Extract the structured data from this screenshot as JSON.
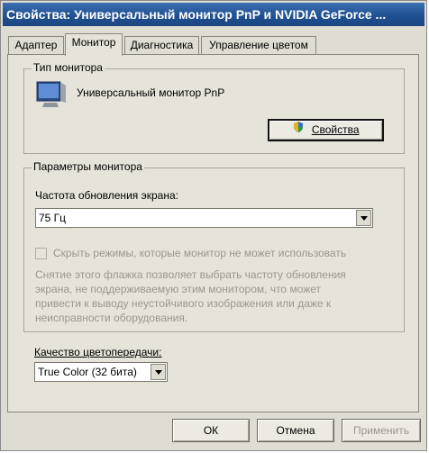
{
  "window": {
    "title": "Свойства: Универсальный монитор PnP и NVIDIA GeForce ..."
  },
  "tabs": [
    {
      "label": "Адаптер",
      "active": false
    },
    {
      "label": "Монитор",
      "active": true
    },
    {
      "label": "Диагностика",
      "active": false
    },
    {
      "label": "Управление цветом",
      "active": false
    }
  ],
  "monitor_type": {
    "group_label": "Тип монитора",
    "monitor_name": "Универсальный монитор PnP",
    "properties_button_label": "Свойства",
    "monitor_icon": "monitor-icon",
    "shield_icon": "shield-icon"
  },
  "monitor_params": {
    "group_label": "Параметры монитора",
    "refresh_rate_label": "Частота обновления экрана:",
    "refresh_rate_value": "75 Гц",
    "hide_modes_label": "Скрыть режимы, которые монитор не может использовать",
    "hide_modes_checked": false,
    "hide_modes_enabled": false,
    "warning_text_line1": "Снятие этого флажка позволяет выбрать частоту обновления",
    "warning_text_line2": "экрана, не поддерживаемую этим монитором, что может",
    "warning_text_line3": "привести к выводу неустойчивого изображения или даже к",
    "warning_text_line4": "неисправности оборудования."
  },
  "color_quality": {
    "label": "Качество цветопередачи:",
    "value": "True Color (32 бита)"
  },
  "footer": {
    "ok_label": "ОК",
    "cancel_label": "Отмена",
    "apply_label": "Применить"
  },
  "colors": {
    "titlebar": "#1f4f8f",
    "dialog_bg": "#dfdcd3",
    "panel_bg": "#e6e3da"
  }
}
